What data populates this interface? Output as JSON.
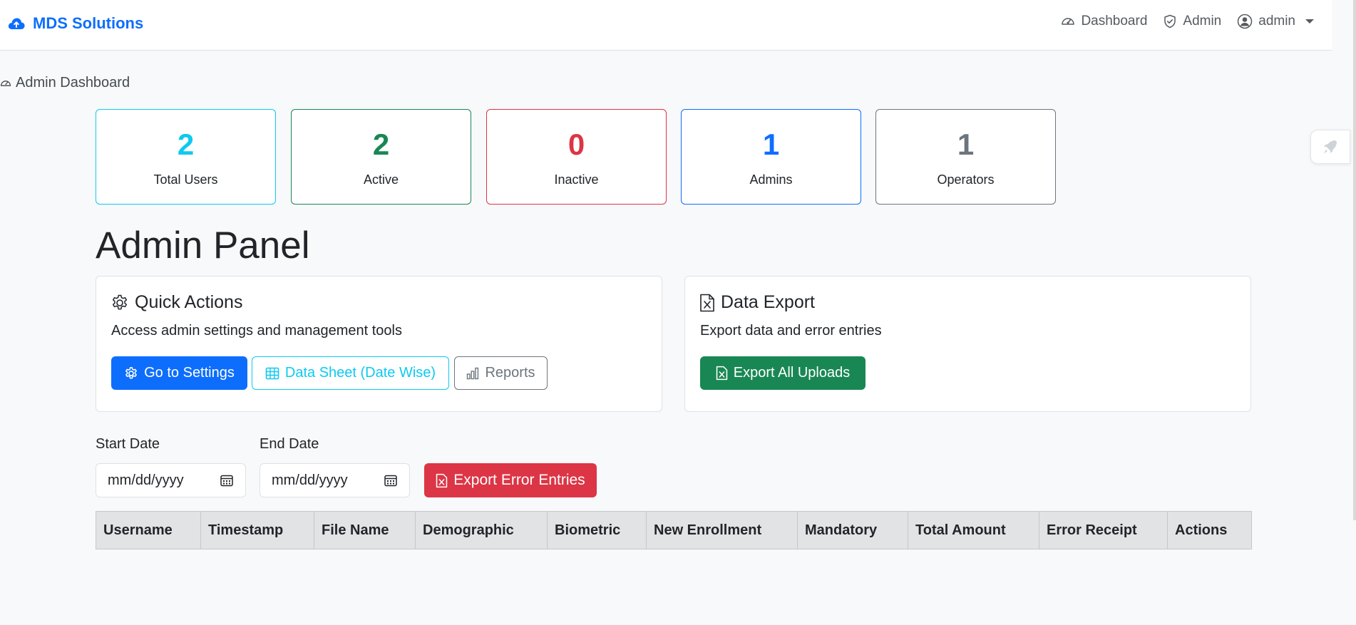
{
  "navbar": {
    "brand": "MDS Solutions",
    "links": [
      {
        "label": "Dashboard",
        "icon": "speedometer-icon"
      },
      {
        "label": "Admin",
        "icon": "shield-icon"
      },
      {
        "label": "admin",
        "icon": "user-circle-icon"
      }
    ]
  },
  "page": {
    "crumb": "Admin Dashboard",
    "title": "Admin Panel"
  },
  "stats": [
    {
      "value": "2",
      "label": "Total Users",
      "color": "#0dcaf0"
    },
    {
      "value": "2",
      "label": "Active",
      "color": "#198754"
    },
    {
      "value": "0",
      "label": "Inactive",
      "color": "#dc3545"
    },
    {
      "value": "1",
      "label": "Admins",
      "color": "#0d6efd"
    },
    {
      "value": "1",
      "label": "Operators",
      "color": "#6c757d"
    }
  ],
  "quick_actions": {
    "title": "Quick Actions",
    "text": "Access admin settings and management tools",
    "buttons": [
      "Go to Settings",
      "Data Sheet (Date Wise)",
      "Reports"
    ]
  },
  "data_export": {
    "title": "Data Export",
    "text": "Export data and error entries",
    "button": "Export All Uploads"
  },
  "filters": {
    "start_label": "Start Date",
    "end_label": "End Date",
    "start_placeholder": "mm/dd/yyyy",
    "end_placeholder": "mm/dd/yyyy",
    "export_errors": "Export Error Entries"
  },
  "table": {
    "columns": [
      "Username",
      "Timestamp",
      "File Name",
      "Demographic",
      "Biometric",
      "New Enrollment",
      "Mandatory",
      "Total Amount",
      "Error Receipt",
      "Actions"
    ]
  },
  "colors": {
    "primary": "#0d6efd",
    "info": "#0dcaf0",
    "success": "#198754",
    "danger": "#dc3545",
    "secondary": "#6c757d"
  }
}
